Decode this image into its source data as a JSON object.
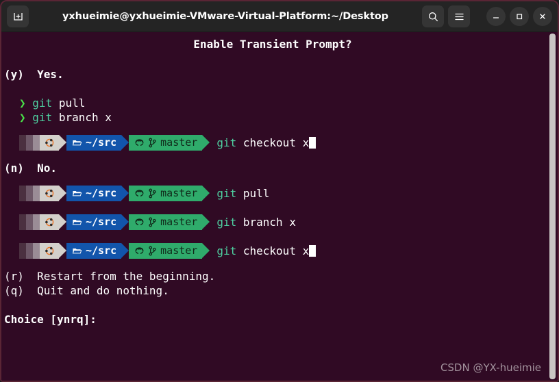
{
  "window": {
    "title": "yxhueimie@yxhueimie-VMware-Virtual-Platform:~/Desktop",
    "bg_color": "#300a24",
    "titlebar_color": "#242424",
    "border_color": "#5a2535"
  },
  "titlebar": {
    "new_tab_label": "",
    "search_label": "",
    "menu_label": "",
    "minimize_label": "",
    "maximize_label": "",
    "close_label": ""
  },
  "terminal": {
    "heading": "Enable Transient Prompt?",
    "option_yes": "(y)  Yes.",
    "option_no": "(n)  No.",
    "option_restart": "(r)  Restart from the beginning.",
    "option_quit": "(q)  Quit and do nothing.",
    "choice_prompt": "Choice [ynrq]:",
    "transient_lines": [
      {
        "chevron": "❯",
        "cmd": "git",
        "args": " pull"
      },
      {
        "chevron": "❯",
        "cmd": "git",
        "args": " branch x"
      }
    ],
    "prompts": [
      {
        "os_icon": "ubuntu-icon",
        "dir": "~/src",
        "branch": "master",
        "cmd": "git",
        "args": " checkout x",
        "cursor": true
      },
      {
        "os_icon": "ubuntu-icon",
        "dir": "~/src",
        "branch": "master",
        "cmd": "git",
        "args": " pull",
        "cursor": false
      },
      {
        "os_icon": "ubuntu-icon",
        "dir": "~/src",
        "branch": "master",
        "cmd": "git",
        "args": " branch x",
        "cursor": false
      },
      {
        "os_icon": "ubuntu-icon",
        "dir": "~/src",
        "branch": "master",
        "cmd": "git",
        "args": " checkout x",
        "cursor": true
      }
    ],
    "colors": {
      "background": "#300a24",
      "foreground": "#ffffff",
      "command": "#4ecfa0",
      "chevron": "#4ae44a",
      "segment_dir": "#1255ab",
      "segment_git": "#2fab6b",
      "segment_os": "#d3d0cb"
    }
  },
  "watermark": {
    "text": "CSDN @YX-hueimie"
  }
}
